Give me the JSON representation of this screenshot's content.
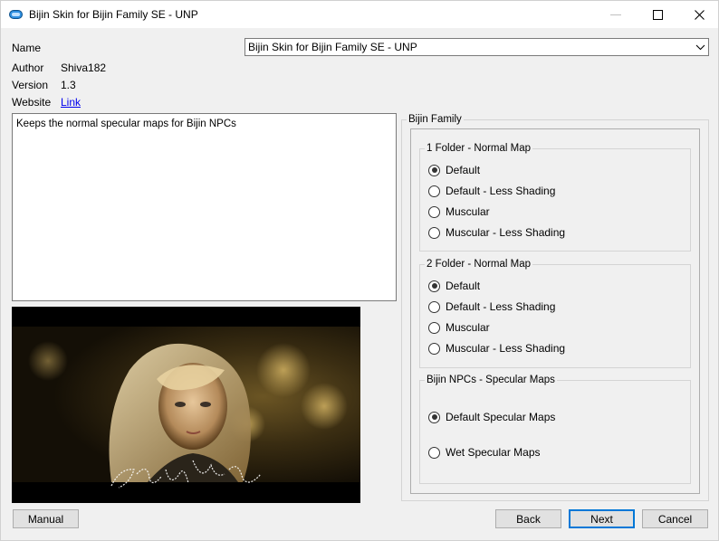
{
  "window": {
    "title": "Bijin Skin for Bijin Family SE - UNP",
    "accent": "#0078d7"
  },
  "fields": {
    "name_label": "Name",
    "name_value": "Bijin Skin for Bijin Family SE - UNP",
    "author_label": "Author",
    "author_value": "Shiva182",
    "version_label": "Version",
    "version_value": "1.3",
    "website_label": "Website",
    "website_link": "Link"
  },
  "description": "Keeps the normal specular maps for Bijin NPCs",
  "preview": {
    "signature_icon": "bijin-signature"
  },
  "options": {
    "group_title": "Bijin Family",
    "groups": [
      {
        "title": "1 Folder - Normal Map",
        "items": [
          {
            "label": "Default",
            "selected": true
          },
          {
            "label": "Default - Less Shading",
            "selected": false
          },
          {
            "label": "Muscular",
            "selected": false
          },
          {
            "label": "Muscular - Less Shading",
            "selected": false
          }
        ]
      },
      {
        "title": "2 Folder - Normal Map",
        "items": [
          {
            "label": "Default",
            "selected": true
          },
          {
            "label": "Default - Less Shading",
            "selected": false
          },
          {
            "label": "Muscular",
            "selected": false
          },
          {
            "label": "Muscular - Less Shading",
            "selected": false
          }
        ]
      },
      {
        "title": "Bijin NPCs - Specular Maps",
        "items": [
          {
            "label": "Default Specular Maps",
            "selected": true
          },
          {
            "label": "Wet Specular Maps",
            "selected": false
          }
        ]
      }
    ]
  },
  "buttons": {
    "manual": "Manual",
    "back": "Back",
    "next": "Next",
    "cancel": "Cancel"
  }
}
